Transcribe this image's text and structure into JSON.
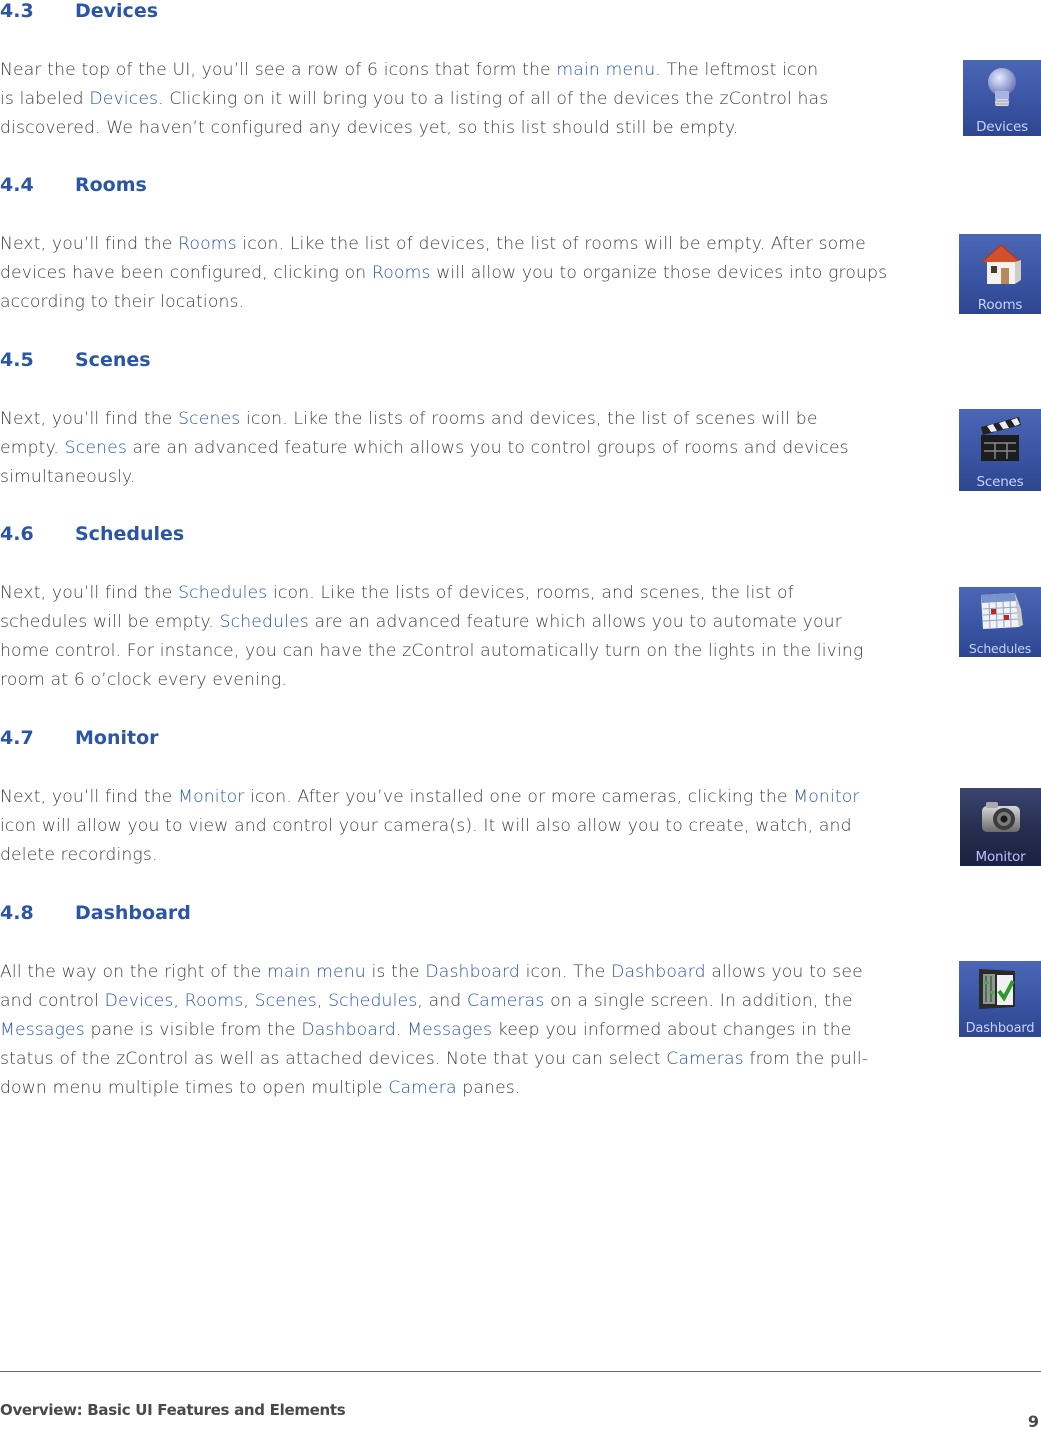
{
  "sections": [
    {
      "number": "4.3",
      "title": "Devices",
      "icon": {
        "name": "lightbulb-icon",
        "caption": "Devices"
      },
      "lines": [
        [
          {
            "t": "Near the top of the UI, you’ll see a row of 6 icons that form the "
          },
          {
            "t": "main menu",
            "link": true
          },
          {
            "t": ". The leftmost icon"
          }
        ],
        [
          {
            "t": "is labeled "
          },
          {
            "t": "Devices",
            "link": true
          },
          {
            "t": ". Clicking on it will bring you to a listing of all of the devices the zControl has"
          }
        ],
        [
          {
            "t": "discovered. We haven’t configured any devices yet, so this list should still be empty."
          }
        ]
      ]
    },
    {
      "number": "4.4",
      "title": "Rooms",
      "icon": {
        "name": "house-icon",
        "caption": "Rooms"
      },
      "lines": [
        [
          {
            "t": "Next, you’ll find the "
          },
          {
            "t": "Rooms",
            "link": true
          },
          {
            "t": " icon. Like the list of devices, the list of rooms will be empty. After some"
          }
        ],
        [
          {
            "t": "devices have been configured, clicking on "
          },
          {
            "t": "Rooms",
            "link": true
          },
          {
            "t": " will allow you to organize those devices into groups"
          }
        ],
        [
          {
            "t": "according to their locations."
          }
        ]
      ]
    },
    {
      "number": "4.5",
      "title": "Scenes",
      "icon": {
        "name": "clapperboard-icon",
        "caption": "Scenes"
      },
      "lines": [
        [
          {
            "t": "Next, you’ll find the "
          },
          {
            "t": "Scenes",
            "link": true
          },
          {
            "t": " icon. Like the lists of rooms and devices, the list of scenes will be"
          }
        ],
        [
          {
            "t": "empty. "
          },
          {
            "t": "Scenes",
            "link": true
          },
          {
            "t": " are an advanced feature which allows you to control groups of rooms and devices"
          }
        ],
        [
          {
            "t": "simultaneously."
          }
        ]
      ]
    },
    {
      "number": "4.6",
      "title": "Schedules",
      "icon": {
        "name": "calendar-icon",
        "caption": "Schedules"
      },
      "lines": [
        [
          {
            "t": "Next, you’ll find the "
          },
          {
            "t": "Schedules",
            "link": true
          },
          {
            "t": " icon. Like the lists of devices, rooms, and scenes, the list of"
          }
        ],
        [
          {
            "t": "schedules will be empty. "
          },
          {
            "t": "Schedules",
            "link": true
          },
          {
            "t": " are an advanced feature which allows you to automate your"
          }
        ],
        [
          {
            "t": "home control. For instance, you can have the zControl automatically turn on the lights in the living"
          }
        ],
        [
          {
            "t": "room at 6 o’clock every evening."
          }
        ]
      ]
    },
    {
      "number": "4.7",
      "title": "Monitor",
      "icon": {
        "name": "camera-icon",
        "caption": "Monitor"
      },
      "lines": [
        [
          {
            "t": "Next, you’ll find the "
          },
          {
            "t": "Monitor",
            "link": true
          },
          {
            "t": " icon. After you’ve installed one or more cameras, clicking the "
          },
          {
            "t": "Monitor",
            "link": true
          }
        ],
        [
          {
            "t": "icon will allow you to view and control your camera(s). It will also allow you to create, watch, and"
          }
        ],
        [
          {
            "t": "delete recordings."
          }
        ]
      ]
    },
    {
      "number": "4.8",
      "title": "Dashboard",
      "icon": {
        "name": "dashboard-checkmark-icon",
        "caption": "Dashboard"
      },
      "lines": [
        [
          {
            "t": "All the way on the right of the "
          },
          {
            "t": "main menu",
            "link": true
          },
          {
            "t": " is the "
          },
          {
            "t": "Dashboard",
            "link": true
          },
          {
            "t": " icon. The "
          },
          {
            "t": "Dashboard",
            "link": true
          },
          {
            "t": " allows you to see"
          }
        ],
        [
          {
            "t": "and control "
          },
          {
            "t": "Devices",
            "link": true
          },
          {
            "t": ", "
          },
          {
            "t": "Rooms",
            "link": true
          },
          {
            "t": ", "
          },
          {
            "t": "Scenes",
            "link": true
          },
          {
            "t": ", "
          },
          {
            "t": "Schedules",
            "link": true
          },
          {
            "t": ", and "
          },
          {
            "t": "Cameras",
            "link": true
          },
          {
            "t": " on a single screen. In addition, the"
          }
        ],
        [
          {
            "t": "Messages",
            "link": true
          },
          {
            "t": " pane is visible from the "
          },
          {
            "t": "Dashboard",
            "link": true
          },
          {
            "t": ". "
          },
          {
            "t": "Messages",
            "link": true
          },
          {
            "t": " keep you informed about changes in the"
          }
        ],
        [
          {
            "t": "status of the zControl as well as attached devices. Note that you can select "
          },
          {
            "t": "Cameras",
            "link": true
          },
          {
            "t": " from the pull-"
          }
        ],
        [
          {
            "t": "down menu multiple times to open multiple "
          },
          {
            "t": "Camera",
            "link": true
          },
          {
            "t": " panes."
          }
        ]
      ]
    }
  ],
  "footer": {
    "title": "Overview:  Basic UI Features and Elements",
    "page_number": "9"
  },
  "colors": {
    "heading": "#2b56a8",
    "link": "#2b56a8",
    "body": "#404040"
  }
}
